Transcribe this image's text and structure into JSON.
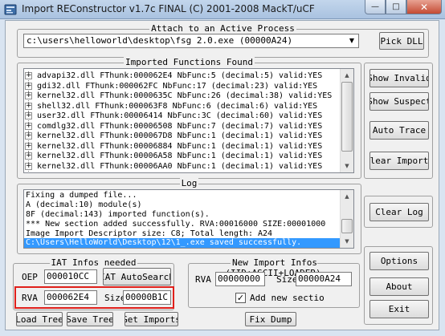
{
  "window": {
    "title": "Import REConstructor v1.7c FINAL (C) 2001-2008 MackT/uCF",
    "min_label": "—",
    "max_label": "□",
    "close_label": "✕"
  },
  "attach": {
    "legend": "Attach to an Active Process",
    "process_value": "c:\\users\\helloworld\\desktop\\fsg 2.0.exe (00000A24)",
    "pick_dll": "Pick DLL"
  },
  "imports": {
    "legend": "Imported Functions Found",
    "rows": [
      "advapi32.dll FThunk:000062E4 NbFunc:5 (decimal:5) valid:YES",
      "gdi32.dll FThunk:000062FC NbFunc:17 (decimal:23) valid:YES",
      "kernel32.dll FThunk:0000635C NbFunc:26 (decimal:38) valid:YES",
      "shell32.dll FThunk:000063F8 NbFunc:6 (decimal:6) valid:YES",
      "user32.dll FThunk:00006414 NbFunc:3C (decimal:60) valid:YES",
      "comdlg32.dll FThunk:00006508 NbFunc:7 (decimal:7) valid:YES",
      "kernel32.dll FThunk:000067D8 NbFunc:1 (decimal:1) valid:YES",
      "kernel32.dll FThunk:00006884 NbFunc:1 (decimal:1) valid:YES",
      "kernel32.dll FThunk:00006A58 NbFunc:1 (decimal:1) valid:YES",
      "kernel32.dll FThunk:00006AA0 NbFunc:1 (decimal:1) valid:YES"
    ]
  },
  "side_buttons": {
    "show_invalid": "Show Invalid",
    "show_suspect": "Show Suspect",
    "auto_trace": "Auto Trace",
    "clear_imports": "Clear Imports",
    "clear_log": "Clear Log",
    "options": "Options",
    "about": "About",
    "exit": "Exit"
  },
  "log": {
    "legend": "Log",
    "lines": [
      "Fixing a dumped file...",
      "A (decimal:10) module(s)",
      "8F (decimal:143) imported function(s).",
      "*** New section added successfully. RVA:00016000 SIZE:00001000",
      "Image Import Descriptor size: C8; Total length: A24"
    ],
    "selected_line": "C:\\Users\\HelloWorld\\Desktop\\12\\1_.exe saved successfully."
  },
  "iat": {
    "legend": "IAT Infos needed",
    "oep_label": "OEP",
    "oep_value": "000010CC",
    "autosearch": "IAT AutoSearch",
    "rva_label": "RVA",
    "rva_value": "000062E4",
    "size_label": "Size",
    "size_value": "00000B1C"
  },
  "new_import": {
    "legend": "New Import Infos (IID+ASCII+LOADER)",
    "rva_label": "RVA",
    "rva_value": "00000000",
    "size_label": "Size",
    "size_value": "00000A24",
    "checkbox_label": "Add new sectio",
    "checked": true
  },
  "bottom_buttons": {
    "load_tree": "Load Tree",
    "save_tree": "Save Tree",
    "get_imports": "Get Imports",
    "fix_dump": "Fix Dump"
  },
  "colors": {
    "selection": "#3399ff",
    "highlight_box": "#e0201b",
    "close_button": "#c44a33"
  }
}
